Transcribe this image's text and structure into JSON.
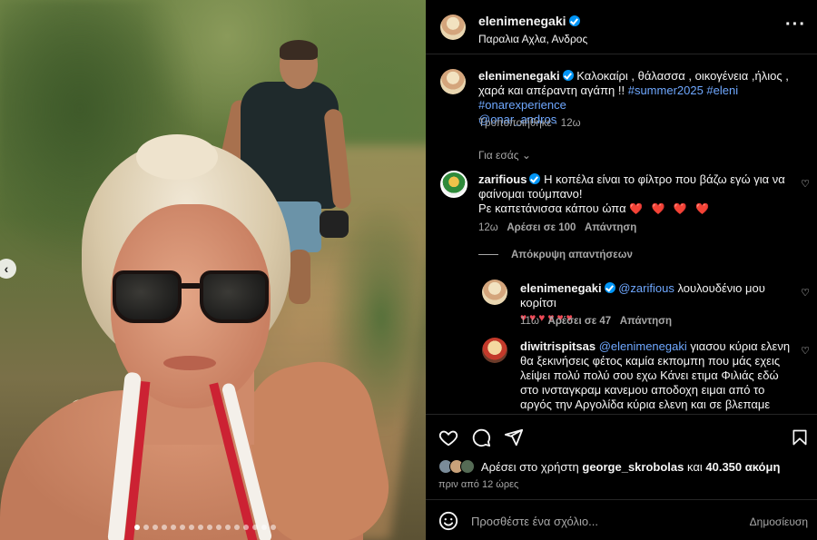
{
  "post": {
    "username": "elenimenegaki",
    "location": "Παραλια Αχλα, Ανδρος",
    "more_icon": "more-horizontal-icon"
  },
  "caption": {
    "username": "elenimenegaki",
    "text": "Καλοκαίρι , θάλασσα , οικογένεια ,ήλιος , χαρά και απέραντη αγάπη !! ",
    "hashtags": "#summer2025 #eleni #onarexperience",
    "mention": "@onar_andros",
    "edited": "Τροποποιήθηκε · 12ω"
  },
  "for_you_label": "Για εσάς",
  "comments": [
    {
      "username": "zarifious",
      "text": "Η κοπέλα είναι το φίλτρο που βάζω εγώ για να φαίνομαι τούμπανο!",
      "text2": "Ρε καπετάνισσα κάπου ώπα",
      "hearts": "❤️ ❤️ ❤️ ❤️",
      "time": "12ω",
      "likes": "Αρέσει σε 100",
      "reply": "Απάντηση"
    }
  ],
  "hide_replies": "Απόκρυψη απαντήσεων",
  "replies": [
    {
      "username": "elenimenegaki",
      "mention": "@zarifious",
      "text": "λουλουδένιο μου κορίτσι",
      "hearts": "♥♥♥♥♥♥",
      "time": "11ω",
      "likes": "Αρέσει σε 47",
      "reply": "Απάντηση"
    },
    {
      "username": "diwitrispitsas",
      "mention": "@elenimenegaki",
      "text": "γιασου κύρια ελενη θα ξεκινήσεις φέτος καμία εκπομπη που μάς εχεις λείψει πολύ πολύ σου εχω Κάνει ετιμα Φιλιάς εδώ στο ινσταγκραμ κανεμου αποδοχη ειμαι από το αργός την Αργολίδα κύρια ελενη και σε βλεπαμε από τον"
    }
  ],
  "likes_line": {
    "prefix": "Αρέσει στο χρήστη",
    "user": "george_skrobolas",
    "middle": "και",
    "count": "40.350 ακόμη"
  },
  "posted_ago": "πριν από 12 ώρες",
  "comment_box": {
    "placeholder": "Προσθέστε ένα σχόλιο...",
    "post_label": "Δημοσίευση"
  },
  "carousel": {
    "dot_count": 16,
    "active_index": 0
  }
}
